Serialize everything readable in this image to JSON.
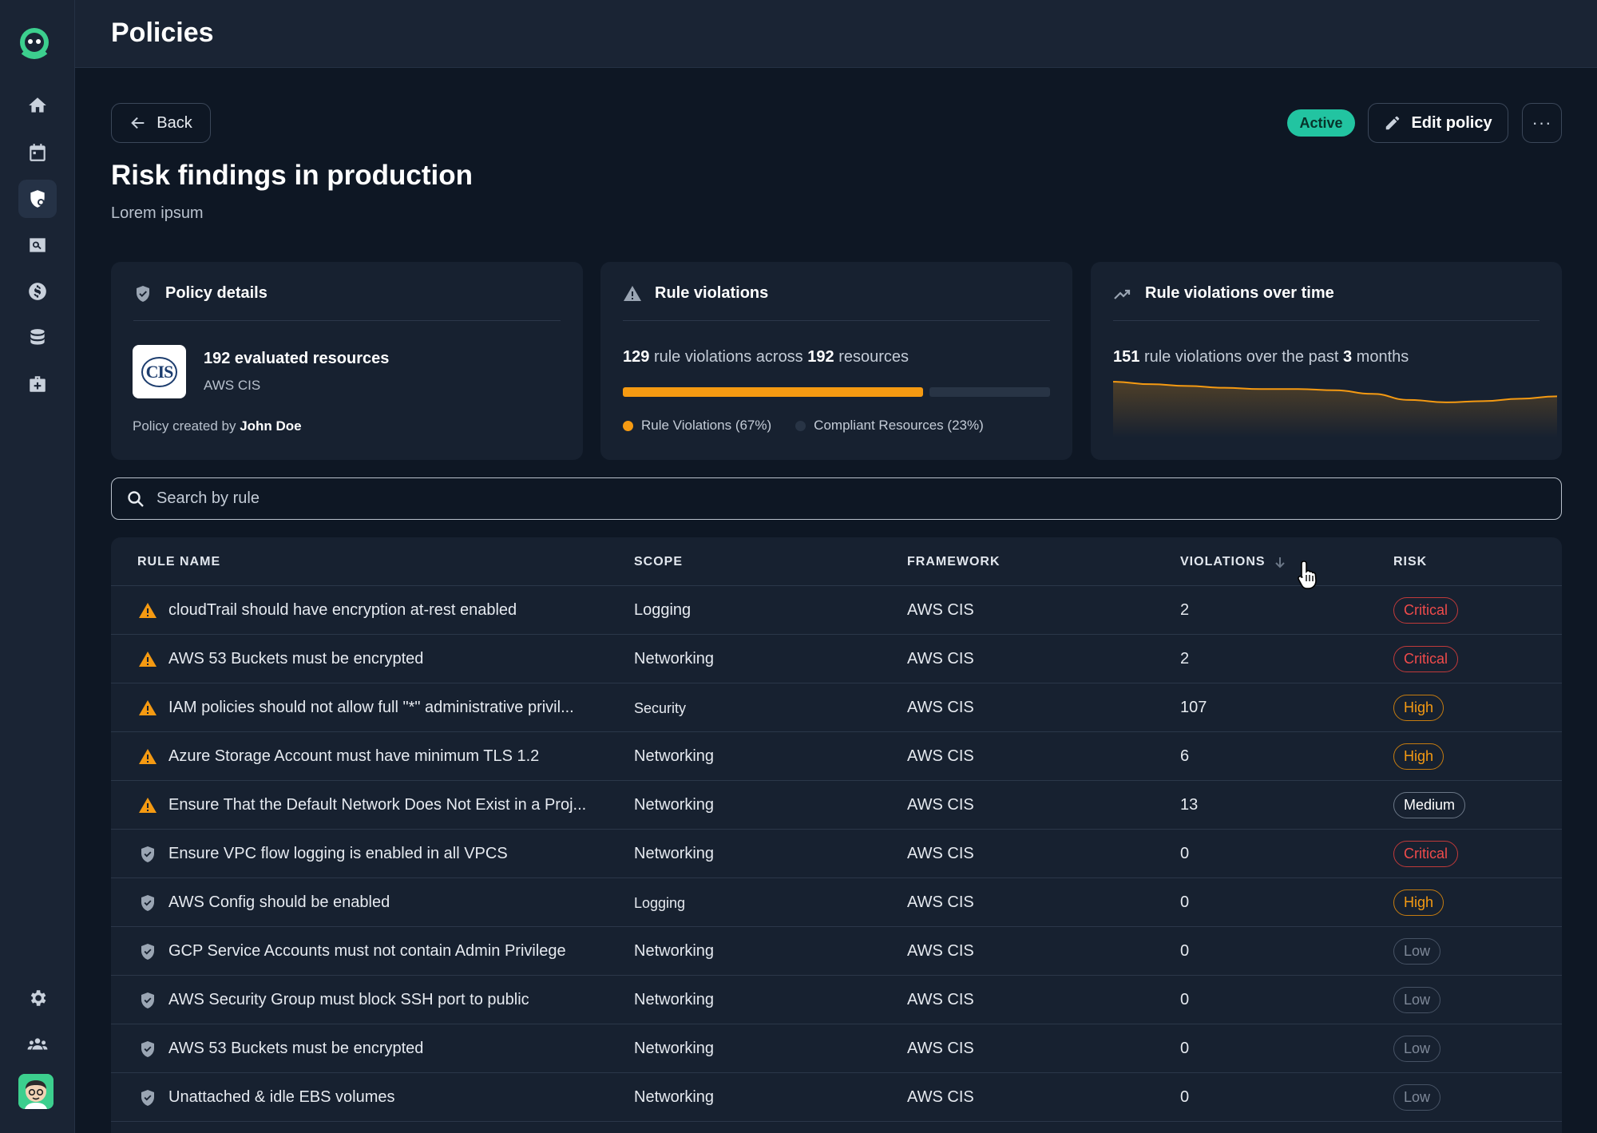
{
  "header": {
    "title": "Policies"
  },
  "sidebar": {
    "items": [
      {
        "icon": "home-icon"
      },
      {
        "icon": "calendar-icon"
      },
      {
        "icon": "shield-icon"
      },
      {
        "icon": "search-icon"
      },
      {
        "icon": "dollar-icon"
      },
      {
        "icon": "database-icon"
      },
      {
        "icon": "briefcase-icon"
      }
    ],
    "bottom": [
      {
        "icon": "gear-icon"
      },
      {
        "icon": "team-icon"
      }
    ]
  },
  "actions": {
    "back_label": "Back",
    "status": "Active",
    "edit_label": "Edit policy",
    "more_label": "···"
  },
  "policy": {
    "title": "Risk findings in production",
    "subtitle": "Lorem ipsum"
  },
  "details_card": {
    "title": "Policy details",
    "resources": "192 evaluated resources",
    "framework": "AWS CIS",
    "logo_text": "CIS",
    "created_by_prefix": "Policy created by",
    "created_by_name": "John Doe"
  },
  "violations_card": {
    "title": "Rule violations",
    "count": "129",
    "mid_text": "rule violations across",
    "resources": "192",
    "suffix": "resources",
    "violation_fraction": 0.67,
    "legend_violations": "Rule Violations (67%)",
    "legend_compliant": "Compliant Resources (23%)",
    "colors": {
      "violations": "#f59a12",
      "compliant": "#283445"
    }
  },
  "trend_card": {
    "title": "Rule violations over time",
    "count": "151",
    "mid_text": "rule violations over the past",
    "months": "3",
    "suffix": "months",
    "trend": [
      0.92,
      0.88,
      0.85,
      0.82,
      0.8,
      0.8,
      0.78,
      0.72,
      0.62,
      0.58,
      0.6,
      0.64,
      0.68
    ]
  },
  "search": {
    "placeholder": "Search by rule"
  },
  "table": {
    "columns": [
      "RULE NAME",
      "SCOPE",
      "FRAMEWORK",
      "VIOLATIONS",
      "RISK"
    ],
    "rows": [
      {
        "icon": "warning",
        "name": "cloudTrail should have encryption at-rest enabled",
        "scope": "Logging",
        "framework": "AWS CIS",
        "violations": "2",
        "risk": "Critical"
      },
      {
        "icon": "warning",
        "name": "AWS 53 Buckets must be encrypted",
        "scope": "Networking",
        "framework": "AWS CIS",
        "violations": "2",
        "risk": "Critical"
      },
      {
        "icon": "warning",
        "name": "IAM policies should not allow full \"*\" administrative privil...",
        "scope": "Security",
        "framework": "AWS CIS",
        "violations": "107",
        "risk": "High"
      },
      {
        "icon": "warning",
        "name": "Azure Storage Account must have minimum TLS 1.2",
        "scope": "Networking",
        "framework": "AWS CIS",
        "violations": "6",
        "risk": "High"
      },
      {
        "icon": "warning",
        "name": "Ensure That the Default Network Does Not Exist in a Proj...",
        "scope": "Networking",
        "framework": "AWS CIS",
        "violations": "13",
        "risk": "Medium"
      },
      {
        "icon": "shield",
        "name": "Ensure VPC flow logging is enabled in all VPCS",
        "scope": "Networking",
        "framework": "AWS CIS",
        "violations": "0",
        "risk": "Critical"
      },
      {
        "icon": "shield",
        "name": "AWS Config should be enabled",
        "scope": "Logging",
        "framework": "AWS CIS",
        "violations": "0",
        "risk": "High"
      },
      {
        "icon": "shield",
        "name": "GCP Service Accounts must not contain Admin Privilege",
        "scope": "Networking",
        "framework": "AWS CIS",
        "violations": "0",
        "risk": "Low"
      },
      {
        "icon": "shield",
        "name": "AWS Security Group must block SSH port to public",
        "scope": "Networking",
        "framework": "AWS CIS",
        "violations": "0",
        "risk": "Low"
      },
      {
        "icon": "shield",
        "name": "AWS 53 Buckets must be encrypted",
        "scope": "Networking",
        "framework": "AWS CIS",
        "violations": "0",
        "risk": "Low"
      },
      {
        "icon": "shield",
        "name": "Unattached & idle EBS volumes",
        "scope": "Networking",
        "framework": "AWS CIS",
        "violations": "0",
        "risk": "Low"
      }
    ]
  },
  "colors": {
    "accent": "#22c4a1",
    "warning": "#f59a12",
    "critical": "#ef4b4b"
  }
}
